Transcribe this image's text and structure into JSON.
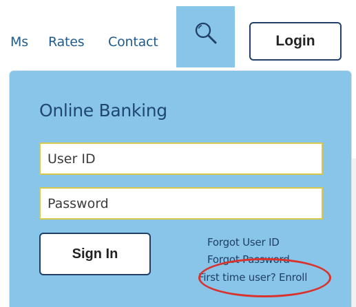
{
  "nav": {
    "links": [
      {
        "label": "Ms"
      },
      {
        "label": "Rates"
      },
      {
        "label": "Contact"
      }
    ],
    "search_icon": "search-icon",
    "login_label": "Login"
  },
  "banking": {
    "title": "Online Banking",
    "user_id_placeholder": "User ID",
    "password_placeholder": "Password",
    "sign_in_label": "Sign In",
    "forgot_user_id": "Forgot User ID",
    "forgot_password": "Forgot Password",
    "first_time_enroll": "First time user? Enroll"
  },
  "colors": {
    "panel": "#88c5e8",
    "link": "#1f5a8f",
    "button_border": "#1f3f66",
    "field_border": "#d8c948",
    "annotation": "#d8332d"
  }
}
